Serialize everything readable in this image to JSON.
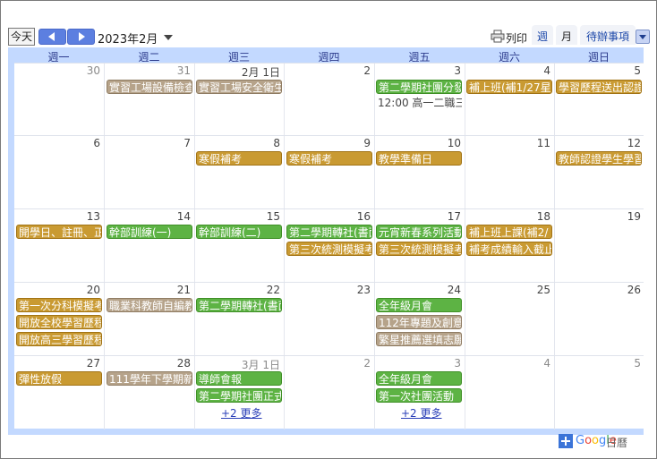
{
  "toolbar": {
    "today_label": "今天",
    "month_label": "2023年2月",
    "print_label": "列印",
    "tab_week": "週",
    "tab_month": "月",
    "tab_agenda": "待辦事項"
  },
  "weekdays": [
    "週一",
    "週二",
    "週三",
    "週四",
    "週五",
    "週六",
    "週日"
  ],
  "weeks": [
    {
      "days": [
        "30",
        "31",
        "2月 1日",
        "2",
        "3",
        "4",
        "5"
      ],
      "other": [
        true,
        true,
        false,
        false,
        false,
        false,
        false
      ]
    },
    {
      "days": [
        "6",
        "7",
        "8",
        "9",
        "10",
        "11",
        "12"
      ],
      "other": [
        false,
        false,
        false,
        false,
        false,
        false,
        false
      ]
    },
    {
      "days": [
        "13",
        "14",
        "15",
        "16",
        "17",
        "18",
        "19"
      ],
      "other": [
        false,
        false,
        false,
        false,
        false,
        false,
        false
      ]
    },
    {
      "days": [
        "20",
        "21",
        "22",
        "23",
        "24",
        "25",
        "26"
      ],
      "other": [
        false,
        false,
        false,
        false,
        false,
        false,
        false
      ]
    },
    {
      "days": [
        "27",
        "28",
        "3月 1日",
        "2",
        "3",
        "4",
        "5"
      ],
      "other": [
        false,
        false,
        true,
        true,
        true,
        true,
        true
      ]
    }
  ],
  "events": {
    "w0": [
      {
        "text": "實習工場設備檢查",
        "color": "tan"
      },
      {
        "text": "實習工場安全衛生",
        "color": "tan"
      },
      {
        "text": "第二學期社團分發",
        "color": "green"
      },
      {
        "text": "12:00 高一二職三",
        "color": "timed"
      },
      {
        "text": "補上班(補1/27星",
        "color": "orange"
      },
      {
        "text": "學習歷程送出認證",
        "color": "orange"
      }
    ],
    "w1": [
      {
        "text": "寒假補考",
        "color": "orange"
      },
      {
        "text": "寒假補考",
        "color": "orange"
      },
      {
        "text": "教學準備日",
        "color": "orange"
      },
      {
        "text": "教師認證學生學習",
        "color": "orange"
      }
    ],
    "w2": [
      {
        "text": "開學日、註冊、正",
        "color": "orange"
      },
      {
        "text": "幹部訓練(一)",
        "color": "green"
      },
      {
        "text": "幹部訓練(二)",
        "color": "green"
      },
      {
        "text": "第二學期轉社(書面",
        "color": "green"
      },
      {
        "text": "元宵新春系列活動",
        "color": "green"
      },
      {
        "text": "補上班上課(補2/",
        "color": "orange"
      },
      {
        "text": "第三次統測模擬考",
        "color": "orange"
      },
      {
        "text": "第三次統測模擬考",
        "color": "orange"
      },
      {
        "text": "補考成績輸入截止",
        "color": "orange"
      }
    ],
    "w3": [
      {
        "text": "第一次分科模擬考",
        "color": "orange"
      },
      {
        "text": "職業科教師自編教",
        "color": "tan"
      },
      {
        "text": "第二學期轉社(書面",
        "color": "green"
      },
      {
        "text": "全年級月會",
        "color": "green"
      },
      {
        "text": "開放全校學習歷程",
        "color": "orange"
      },
      {
        "text": "112年專題及創意",
        "color": "tan"
      },
      {
        "text": "開放高三學習歷程",
        "color": "orange"
      },
      {
        "text": "繁星推薦選填志願",
        "color": "tan"
      }
    ],
    "w4": [
      {
        "text": "彈性放假",
        "color": "orange"
      },
      {
        "text": "111學年下學期新",
        "color": "tan"
      },
      {
        "text": "導師會報",
        "color": "green"
      },
      {
        "text": "全年級月會",
        "color": "green"
      },
      {
        "text": "第二學期社團正式",
        "color": "green"
      },
      {
        "text": "第一次社團活動",
        "color": "green"
      }
    ],
    "more": [
      "+2 更多",
      "+2 更多"
    ]
  },
  "footer": {
    "google": "Google",
    "sub": "日曆"
  },
  "colors": {
    "orange": "#c99a32",
    "tan": "#b6a38a",
    "green": "#5db344",
    "header_bg": "#c3d9ff",
    "nav": "#5c7fe0"
  }
}
